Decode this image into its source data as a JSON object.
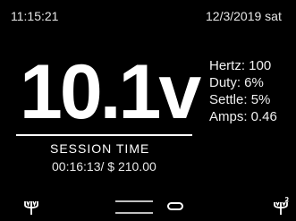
{
  "status_bar": {
    "time": "11:15:21",
    "date": "12/3/2019 sat"
  },
  "main": {
    "voltage": "10.1v",
    "session_label": "SESSION TIME",
    "session_value": "00:16:13/ $ 210.00"
  },
  "stats": [
    {
      "label": "Hertz: 100"
    },
    {
      "label": "Duty: 6%"
    },
    {
      "label": "Settle: 5%"
    },
    {
      "label": "Amps: 0.46"
    }
  ],
  "bottom": {
    "left_icon": "trident-icon",
    "right_icon": "trident-2-icon",
    "menu_icon": "menu-lines-icon",
    "toggle_icon": "pill-button-icon"
  }
}
